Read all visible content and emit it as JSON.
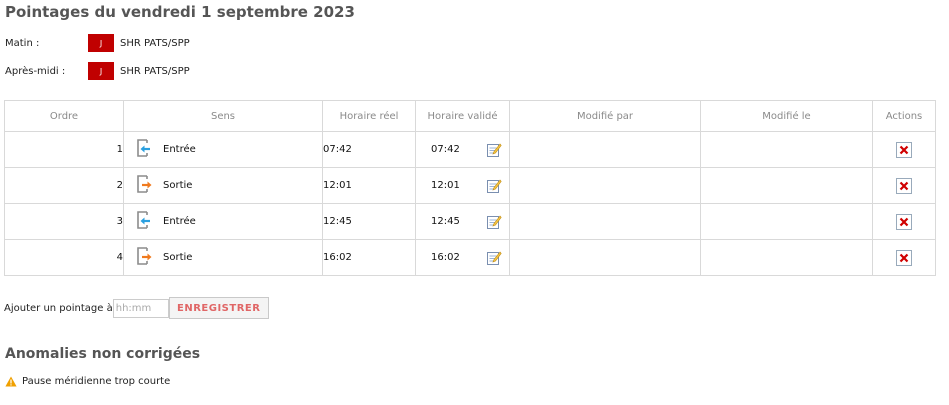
{
  "title": "Pointages du vendredi 1 septembre 2023",
  "periods": [
    {
      "label": "Matin :",
      "badge": "J",
      "text": "SHR PATS/SPP"
    },
    {
      "label": "Après-midi :",
      "badge": "J",
      "text": "SHR PATS/SPP"
    }
  ],
  "table": {
    "headers": [
      "Ordre",
      "Sens",
      "Horaire réel",
      "Horaire validé",
      "Modifié par",
      "Modifié le",
      "Actions"
    ],
    "rows": [
      {
        "ordre": "1",
        "sens": "Entrée",
        "direction": "in",
        "reel": "07:42",
        "valide": "07:42",
        "modifie_par": "",
        "modifie_le": ""
      },
      {
        "ordre": "2",
        "sens": "Sortie",
        "direction": "out",
        "reel": "12:01",
        "valide": "12:01",
        "modifie_par": "",
        "modifie_le": ""
      },
      {
        "ordre": "3",
        "sens": "Entrée",
        "direction": "in",
        "reel": "12:45",
        "valide": "12:45",
        "modifie_par": "",
        "modifie_le": ""
      },
      {
        "ordre": "4",
        "sens": "Sortie",
        "direction": "out",
        "reel": "16:02",
        "valide": "16:02",
        "modifie_par": "",
        "modifie_le": ""
      }
    ]
  },
  "add": {
    "label": "Ajouter un pointage à",
    "placeholder": "hh:mm",
    "button": "ENREGISTRER"
  },
  "anomalies": {
    "title": "Anomalies non corrigées",
    "items": [
      "Pause méridienne trop courte"
    ]
  },
  "icons": {
    "entry": "door-arrow-in-icon",
    "exit": "door-arrow-out-icon",
    "edit": "edit-pencil-icon",
    "delete": "delete-x-icon",
    "warning": "warning-triangle-icon"
  },
  "colors": {
    "badge": "#c00000",
    "entry_arrow": "#2aa0e0",
    "exit_arrow": "#f07a1e",
    "delete": "#d00000",
    "warning": "#f0a000",
    "save_text": "#e06666"
  }
}
